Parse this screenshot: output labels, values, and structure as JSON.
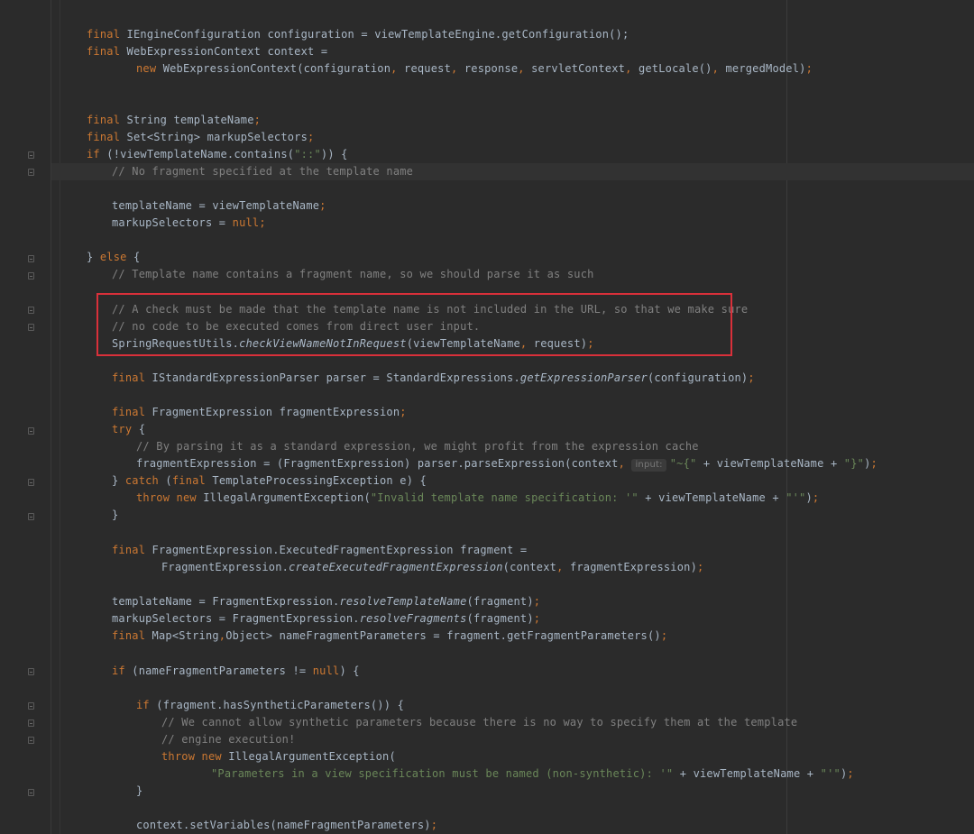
{
  "editor": {
    "inlay_hint": "input:",
    "lines": [
      "final IEngineConfiguration configuration = viewTemplateEngine.getConfiguration();",
      "final WebExpressionContext context =",
      "new WebExpressionContext(configuration, request, response, servletContext, getLocale(), mergedModel);",
      "final String templateName;",
      "final Set<String> markupSelectors;",
      "if (!viewTemplateName.contains(\"::\")) {",
      "// No fragment specified at the template name",
      "templateName = viewTemplateName;",
      "markupSelectors = null;",
      "} else {",
      "// Template name contains a fragment name, so we should parse it as such",
      "// A check must be made that the template name is not included in the URL, so that we make sure",
      "// no code to be executed comes from direct user input.",
      "SpringRequestUtils.checkViewNameNotInRequest(viewTemplateName, request);",
      "final IStandardExpressionParser parser = StandardExpressions.getExpressionParser(configuration);",
      "final FragmentExpression fragmentExpression;",
      "try {",
      "// By parsing it as a standard expression, we might profit from the expression cache",
      "fragmentExpression = (FragmentExpression) parser.parseExpression(context, \"~{\" + viewTemplateName + \"}\");",
      "} catch (final TemplateProcessingException e) {",
      "throw new IllegalArgumentException(\"Invalid template name specification: '\" + viewTemplateName + \"'\");",
      "}",
      "final FragmentExpression.ExecutedFragmentExpression fragment =",
      "FragmentExpression.createExecutedFragmentExpression(context, fragmentExpression);",
      "templateName = FragmentExpression.resolveTemplateName(fragment);",
      "markupSelectors = FragmentExpression.resolveFragments(fragment);",
      "final Map<String,Object> nameFragmentParameters = fragment.getFragmentParameters();",
      "if (nameFragmentParameters != null) {",
      "if (fragment.hasSyntheticParameters()) {",
      "// We cannot allow synthetic parameters because there is no way to specify them at the template",
      "// engine execution!",
      "throw new IllegalArgumentException(",
      "\"Parameters in a view specification must be named (non-synthetic): '\" + viewTemplateName + \"'\");",
      "}",
      "context.setVariables(nameFragmentParameters);"
    ]
  },
  "colors": {
    "background": "#2b2b2b",
    "keyword": "#cc7832",
    "string": "#6a8759",
    "comment": "#808080",
    "identifier": "#a9b7c6",
    "highlight_box": "#d9303a"
  }
}
